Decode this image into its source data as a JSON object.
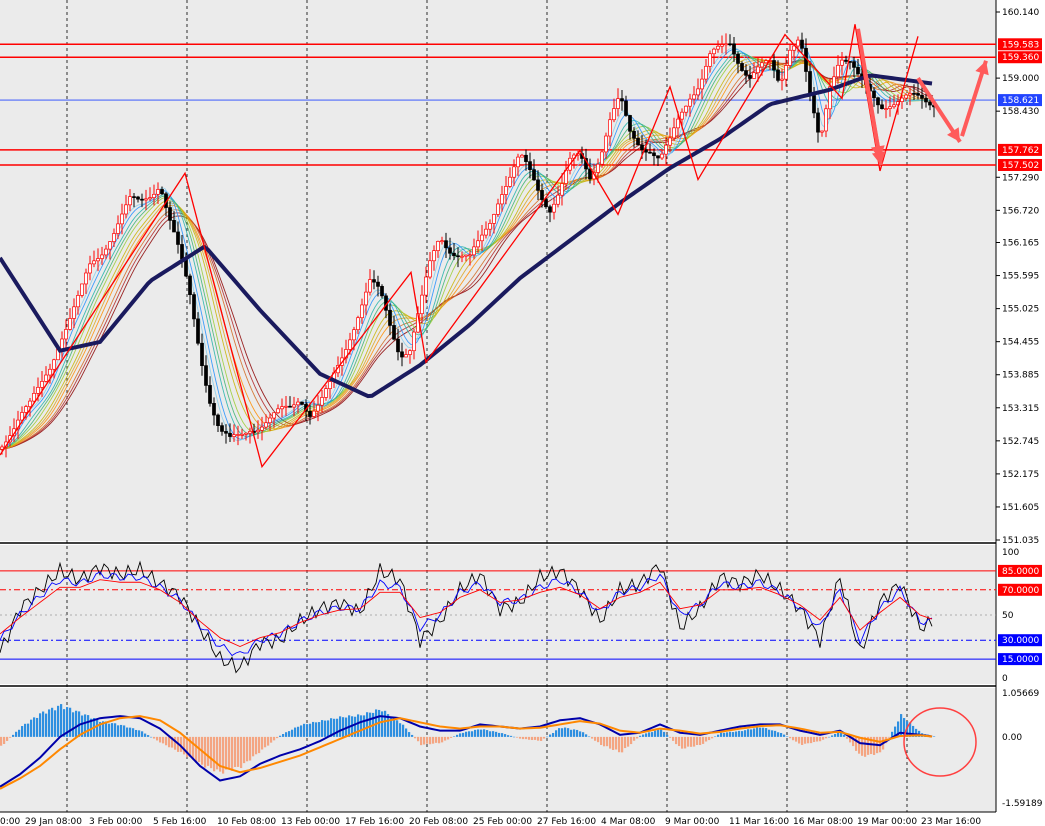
{
  "chart_data": [
    {
      "type": "candlestick",
      "panel": "price",
      "y_ticks": [
        "160.140",
        "159.000",
        "158.430",
        "157.290",
        "156.720",
        "156.165",
        "155.595",
        "155.025",
        "154.455",
        "153.885",
        "153.315",
        "152.745",
        "152.175",
        "151.605",
        "151.035"
      ],
      "ylim": [
        151.035,
        160.14
      ],
      "grid": "vertical dashed",
      "horizontal_levels": [
        {
          "label": "159.583",
          "value": 159.583,
          "color": "#ff0000"
        },
        {
          "label": "159.360",
          "value": 159.36,
          "color": "#ff0000"
        },
        {
          "label": "158.621",
          "value": 158.621,
          "color": "#2244ff"
        },
        {
          "label": "157.762",
          "value": 157.762,
          "color": "#ff0000"
        },
        {
          "label": "157.502",
          "value": 157.502,
          "color": "#ff0000"
        }
      ],
      "close_series": {
        "name": "close",
        "x": [
          0,
          10,
          20,
          30,
          40,
          50,
          60,
          70,
          80,
          90,
          100,
          110,
          120,
          130,
          140,
          150,
          160,
          170,
          180,
          190,
          200,
          210,
          220,
          230,
          240,
          250,
          260,
          270,
          280,
          290,
          300,
          310,
          320,
          330,
          340,
          350,
          360,
          370,
          380,
          390,
          400,
          410,
          420,
          430,
          440,
          450,
          460,
          470,
          480,
          490,
          500,
          510,
          520,
          530,
          540,
          550,
          560,
          570,
          580,
          590,
          600,
          610,
          620,
          630,
          640,
          650,
          660,
          670,
          680,
          690,
          700,
          710,
          720,
          730,
          740,
          750,
          760,
          770,
          780,
          790,
          800,
          810,
          820,
          830,
          840,
          850,
          860,
          870,
          880,
          890,
          900,
          910,
          920,
          930
        ],
        "values": [
          152.6,
          152.95,
          153.25,
          153.35,
          153.6,
          154.0,
          154.55,
          154.9,
          155.25,
          155.7,
          155.95,
          156.3,
          156.6,
          156.85,
          156.8,
          157.0,
          157.25,
          156.55,
          155.9,
          155.2,
          154.3,
          153.5,
          152.9,
          152.7,
          152.8,
          153.0,
          153.05,
          153.1,
          153.2,
          153.3,
          153.55,
          153.25,
          153.35,
          153.65,
          154.1,
          154.6,
          155.05,
          155.45,
          155.25,
          154.75,
          154.3,
          154.35,
          155.0,
          155.75,
          156.3,
          156.1,
          155.95,
          155.85,
          156.15,
          156.55,
          157.05,
          157.3,
          157.6,
          157.35,
          157.05,
          156.8,
          157.05,
          157.5,
          157.65,
          157.35,
          157.7,
          158.25,
          158.6,
          158.05,
          157.9,
          157.8,
          157.55,
          157.85,
          158.35,
          158.75,
          158.95,
          159.35,
          159.45,
          159.6,
          159.3,
          159.05,
          159.15,
          159.2,
          158.9,
          159.6,
          159.75,
          158.6,
          157.8,
          158.9,
          159.45,
          159.3,
          158.9,
          158.7,
          158.55,
          158.62,
          158.62,
          158.62,
          158.62,
          158.62
        ]
      },
      "zigzag": {
        "x": [
          0,
          185,
          262,
          411,
          426,
          580,
          618,
          670,
          698,
          785,
          842,
          855,
          880,
          918
        ],
        "values": [
          152.5,
          157.36,
          152.3,
          155.65,
          154.1,
          157.75,
          156.65,
          158.85,
          157.25,
          159.75,
          158.65,
          159.93,
          157.4,
          159.72
        ]
      },
      "ma_thick": {
        "x": [
          0,
          60,
          100,
          150,
          205,
          260,
          320,
          370,
          420,
          470,
          520,
          570,
          620,
          670,
          720,
          770,
          830,
          870,
          935
        ],
        "values": [
          155.9,
          154.3,
          154.45,
          155.5,
          156.1,
          155.0,
          153.9,
          153.5,
          154.05,
          154.75,
          155.55,
          156.2,
          156.85,
          157.45,
          157.95,
          158.55,
          158.8,
          159.05,
          158.9
        ]
      },
      "arrows": [
        {
          "from": [
            865,
            159.1
          ],
          "to": [
            880,
            157.6
          ]
        },
        {
          "from": [
            918,
            159.0
          ],
          "to": [
            960,
            157.9
          ]
        },
        {
          "from": [
            962,
            158.0
          ],
          "to": [
            986,
            159.3
          ]
        },
        {
          "from": [
            858,
            159.85
          ],
          "to": [
            881,
            157.5
          ]
        }
      ]
    },
    {
      "type": "line",
      "panel": "stochastic",
      "y_ticks": [
        "100",
        "50",
        "0"
      ],
      "ylim": [
        0,
        100
      ],
      "levels": [
        {
          "label": "85.0000",
          "value": 85,
          "color": "#ff0000",
          "style": "solid"
        },
        {
          "label": "70.0000",
          "value": 70,
          "color": "#ff0000",
          "style": "dashdot"
        },
        {
          "label": "30.0000",
          "value": 30,
          "color": "#0000ff",
          "style": "dashdot"
        },
        {
          "label": "15.0000",
          "value": 15,
          "color": "#0000ff",
          "style": "solid"
        }
      ],
      "x": [
        0,
        20,
        40,
        60,
        80,
        100,
        120,
        140,
        160,
        180,
        200,
        220,
        240,
        260,
        280,
        300,
        320,
        340,
        360,
        380,
        400,
        420,
        440,
        460,
        480,
        500,
        520,
        540,
        560,
        580,
        600,
        620,
        640,
        660,
        680,
        700,
        720,
        740,
        760,
        780,
        800,
        820,
        840,
        860,
        880,
        900,
        920,
        935
      ],
      "series": [
        {
          "name": "fast",
          "color": "#000000",
          "values": [
            20,
            55,
            70,
            85,
            78,
            88,
            82,
            86,
            75,
            65,
            40,
            15,
            8,
            28,
            30,
            45,
            55,
            60,
            52,
            85,
            78,
            30,
            45,
            70,
            82,
            55,
            60,
            80,
            85,
            70,
            45,
            70,
            75,
            90,
            40,
            55,
            80,
            75,
            82,
            70,
            55,
            30,
            80,
            20,
            60,
            75,
            40,
            45
          ]
        },
        {
          "name": "mid",
          "color": "#0000ff",
          "values": [
            30,
            50,
            65,
            78,
            75,
            82,
            80,
            80,
            72,
            62,
            42,
            25,
            18,
            30,
            35,
            45,
            52,
            56,
            55,
            75,
            72,
            40,
            50,
            68,
            75,
            60,
            62,
            72,
            78,
            68,
            52,
            68,
            72,
            82,
            50,
            58,
            75,
            72,
            76,
            68,
            56,
            40,
            70,
            30,
            55,
            70,
            45,
            45
          ]
        },
        {
          "name": "slow",
          "color": "#ff0000",
          "values": [
            35,
            48,
            60,
            72,
            72,
            78,
            76,
            76,
            70,
            60,
            45,
            32,
            25,
            32,
            36,
            44,
            50,
            54,
            55,
            68,
            68,
            48,
            52,
            64,
            70,
            60,
            62,
            68,
            72,
            66,
            55,
            64,
            68,
            76,
            55,
            58,
            70,
            70,
            72,
            66,
            58,
            46,
            64,
            38,
            52,
            64,
            50,
            46
          ]
        }
      ]
    },
    {
      "type": "bar",
      "panel": "oscillator",
      "y_ticks": [
        "1.05669",
        "0.00",
        "-1.59189"
      ],
      "ylim": [
        -1.59189,
        1.05669
      ],
      "x": [
        0,
        20,
        40,
        60,
        80,
        100,
        120,
        140,
        160,
        180,
        200,
        220,
        240,
        260,
        280,
        300,
        320,
        340,
        360,
        380,
        400,
        420,
        440,
        460,
        480,
        500,
        520,
        540,
        560,
        580,
        600,
        620,
        640,
        660,
        680,
        700,
        720,
        740,
        760,
        780,
        800,
        820,
        840,
        860,
        880,
        900,
        920,
        935
      ],
      "values": [
        -0.25,
        0.25,
        0.6,
        0.8,
        0.6,
        0.4,
        0.3,
        0.15,
        -0.15,
        -0.4,
        -0.7,
        -0.9,
        -0.75,
        -0.35,
        0.05,
        0.3,
        0.4,
        0.5,
        0.55,
        0.7,
        0.35,
        -0.2,
        -0.15,
        0.1,
        0.2,
        0.1,
        -0.05,
        -0.1,
        0.25,
        0.15,
        -0.2,
        -0.4,
        0.05,
        0.2,
        -0.3,
        -0.2,
        0.1,
        0.15,
        0.25,
        0.1,
        -0.2,
        -0.1,
        0.15,
        -0.5,
        -0.4,
        0.55,
        0.1,
        0.0
      ],
      "series": [
        {
          "name": "signal",
          "color": "#0000aa",
          "values": [
            -1.2,
            -0.9,
            -0.5,
            0.0,
            0.3,
            0.45,
            0.5,
            0.45,
            0.2,
            -0.2,
            -0.7,
            -1.05,
            -0.95,
            -0.65,
            -0.45,
            -0.3,
            -0.1,
            0.15,
            0.35,
            0.5,
            0.45,
            0.25,
            0.15,
            0.15,
            0.3,
            0.25,
            0.2,
            0.25,
            0.4,
            0.45,
            0.3,
            0.05,
            0.1,
            0.3,
            0.1,
            0.05,
            0.15,
            0.25,
            0.3,
            0.3,
            0.15,
            0.05,
            0.15,
            -0.15,
            -0.2,
            0.1,
            0.05,
            0.0
          ]
        },
        {
          "name": "average",
          "color": "#ff8800",
          "values": [
            -1.25,
            -1.0,
            -0.7,
            -0.3,
            0.05,
            0.3,
            0.45,
            0.5,
            0.4,
            0.1,
            -0.3,
            -0.7,
            -0.85,
            -0.75,
            -0.6,
            -0.45,
            -0.25,
            -0.05,
            0.15,
            0.35,
            0.45,
            0.35,
            0.25,
            0.2,
            0.25,
            0.25,
            0.2,
            0.22,
            0.3,
            0.38,
            0.32,
            0.15,
            0.1,
            0.2,
            0.15,
            0.08,
            0.12,
            0.2,
            0.26,
            0.28,
            0.2,
            0.1,
            0.12,
            -0.02,
            -0.12,
            0.02,
            0.04,
            0.0
          ]
        }
      ]
    }
  ],
  "x_labels": [
    "0:00",
    "29 Jan 08:00",
    "3 Feb 00:00",
    "5 Feb 16:00",
    "10 Feb 08:00",
    "13 Feb 00:00",
    "17 Feb 16:00",
    "20 Feb 08:00",
    "25 Feb 00:00",
    "27 Feb 16:00",
    "4 Mar 08:00",
    "9 Mar 00:00",
    "11 Mar 16:00",
    "16 Mar 08:00",
    "19 Mar 00:00",
    "23 Mar 16:00"
  ],
  "colors": {
    "background": "#ebebeb",
    "bull": "#ff0000",
    "bear": "#000000",
    "annotation": "#ff5a5a"
  }
}
